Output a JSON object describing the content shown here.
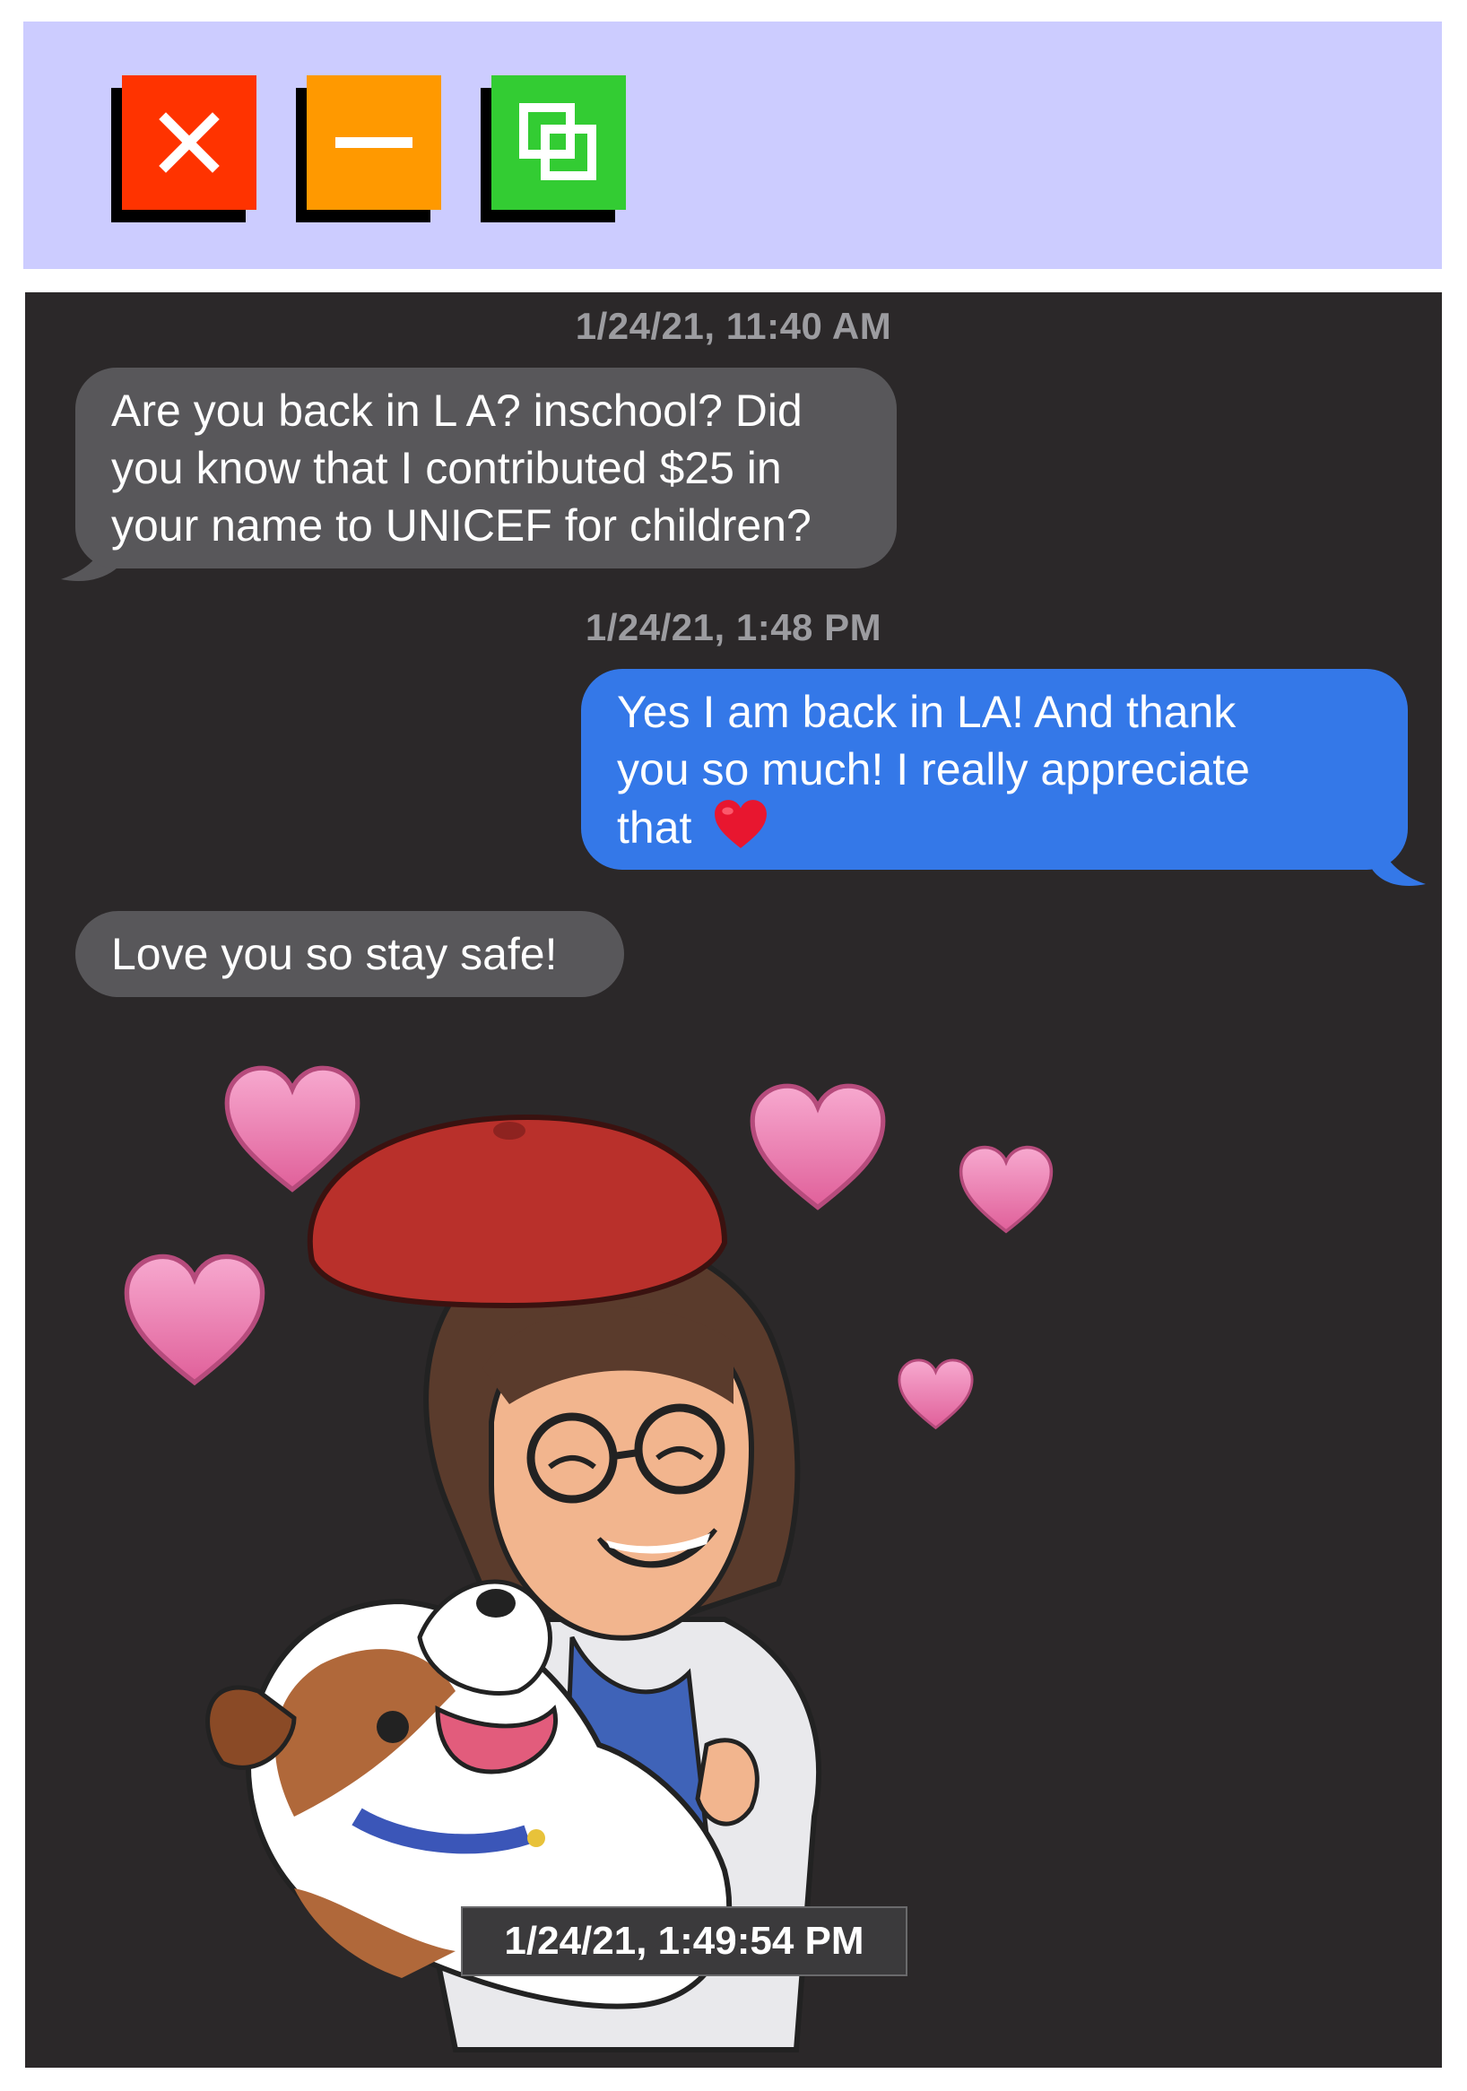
{
  "window": {
    "close_icon": "close-icon",
    "minimize_icon": "minimize-icon",
    "restore_icon": "restore-icon",
    "close_color": "#ff3300",
    "minimize_color": "#ff9900",
    "restore_color": "#33cc33"
  },
  "conversation": {
    "background": "#2b2829",
    "incoming_color": "#58575a",
    "outgoing_color": "#3478e8",
    "timestamp_1": "1/24/21, 11:40 AM",
    "message_1": {
      "line_1": "Are you back in L A? inschool? Did",
      "line_2": "you know that I contributed $25 in",
      "line_3": "your name to UNICEF for children?"
    },
    "timestamp_2": "1/24/21, 1:48 PM",
    "message_2": {
      "line_1": "Yes I am back in LA! And thank",
      "line_2": "you so much! I really appreciate",
      "line_3": "that",
      "emoji": "red-heart-emoji"
    },
    "message_3": "Love you so stay safe!",
    "sticker": "bitmoji-hugging-dog-with-hearts",
    "tooltip": "1/24/21, 1:49:54 PM"
  }
}
